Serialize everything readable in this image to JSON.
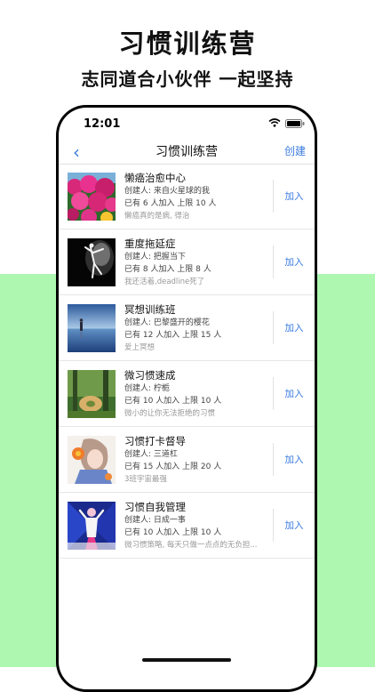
{
  "promo": {
    "title": "习惯训练营",
    "subtitle": "志同道合小伙伴 一起坚持"
  },
  "status_bar": {
    "time": "12:01"
  },
  "nav": {
    "back_icon": "chevron-left-icon",
    "title": "习惯训练营",
    "create_label": "创建"
  },
  "groups": [
    {
      "title": "懒癌治愈中心",
      "creator": "创建人: 来自火星球的我",
      "stats": "已有 6 人加入   上限 10 人",
      "desc": "懒癌真的是病, 得治",
      "join_label": "加入",
      "thumb": "flowers"
    },
    {
      "title": "重度拖延症",
      "creator": "创建人: 把握当下",
      "stats": "已有 8 人加入   上限 8 人",
      "desc": "我还活着,deadline死了",
      "join_label": "加入",
      "thumb": "dancer"
    },
    {
      "title": "冥想训练班",
      "creator": "创建人: 巴黎盛开的樱花",
      "stats": "已有 12 人加入   上限 15 人",
      "desc": "爱上冥想",
      "join_label": "加入",
      "thumb": "sea"
    },
    {
      "title": "微习惯速成",
      "creator": "创建人: 柠栀",
      "stats": "已有 10 人加入   上限 10 人",
      "desc": "微小的让你无法拒绝的习惯",
      "join_label": "加入",
      "thumb": "forest"
    },
    {
      "title": "习惯打卡督导",
      "creator": "创建人: 三道杠",
      "stats": "已有 15 人加入   上限 20 人",
      "desc": "3班宇宙最强",
      "join_label": "加入",
      "thumb": "anime"
    },
    {
      "title": "习惯自我管理",
      "creator": "创建人: 日成一事",
      "stats": "已有 10 人加入   上限 10 人",
      "desc": "微习惯策略, 每天只做一点点的无负担...",
      "join_label": "加入",
      "thumb": "poster"
    }
  ]
}
